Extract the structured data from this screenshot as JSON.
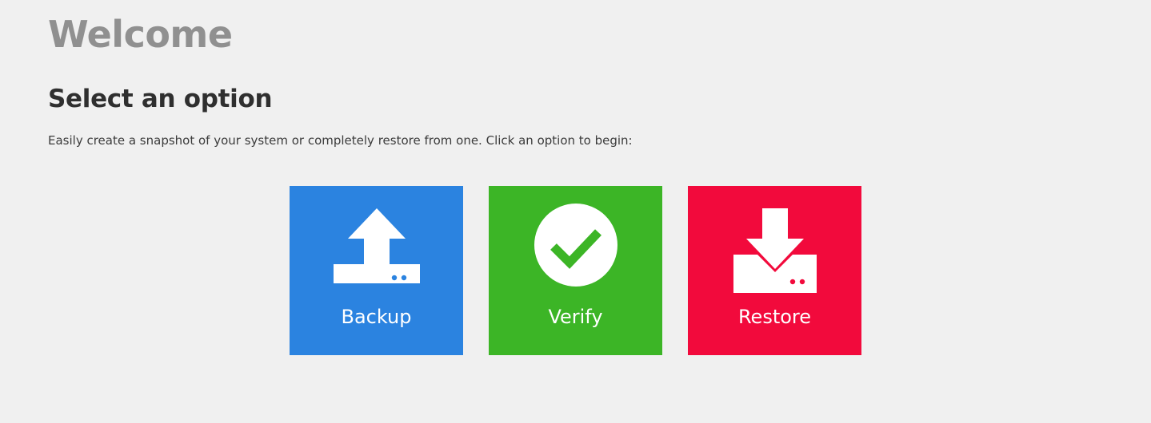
{
  "page": {
    "title": "Welcome",
    "subtitle": "Select an option",
    "description": "Easily create a snapshot of your system or completely restore from one. Click an option to begin:"
  },
  "options": [
    {
      "label": "Backup",
      "icon": "upload-to-drive-icon",
      "color": "#2b83e0"
    },
    {
      "label": "Verify",
      "icon": "check-circle-icon",
      "color": "#3cb526"
    },
    {
      "label": "Restore",
      "icon": "download-to-drive-icon",
      "color": "#f20a3c"
    }
  ]
}
